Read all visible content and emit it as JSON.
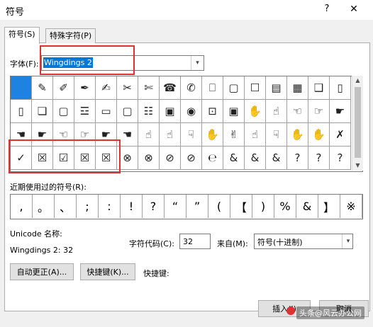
{
  "window": {
    "title": "符号",
    "help_glyph": "?",
    "close_glyph": "✕"
  },
  "tabs": [
    {
      "label": "符号(S)"
    },
    {
      "label": "特殊字符(P)"
    }
  ],
  "font": {
    "label": "字体(F):",
    "value": "Wingdings 2",
    "arrow": "▾"
  },
  "symbol_grid": {
    "selected_index": 0,
    "rows": [
      [
        "",
        "✎",
        "✐",
        "✒",
        "✍",
        "✂",
        "✄",
        "☎",
        "✆",
        "⎕",
        "▢",
        "☐",
        "▤",
        "▦",
        "❑",
        "▯"
      ],
      [
        "▯",
        "❏",
        "▢",
        "☲",
        "▭",
        "▢",
        "☷",
        "▣",
        "◉",
        "⊡",
        "▣",
        "✋",
        "☝",
        "☜",
        "☞",
        "☛"
      ],
      [
        "☚",
        "☛",
        "☜",
        "☞",
        "☛",
        "☚",
        "☝",
        "☝",
        "☟",
        "✋",
        "✌",
        "☝",
        "☟",
        "✋",
        "✋",
        "✗"
      ],
      [
        "✓",
        "☒",
        "☑",
        "☒",
        "☒",
        "⊗",
        "⊗",
        "⊘",
        "⊘",
        "℮",
        "&",
        "&",
        "&",
        "?",
        "?",
        "?"
      ]
    ]
  },
  "recent": {
    "label": "近期使用过的符号(R):",
    "items": [
      ",",
      "。",
      "、",
      ";",
      ":",
      "!",
      "?",
      "“",
      "”",
      "(",
      "【",
      ")",
      "%",
      "&",
      "】",
      "※"
    ]
  },
  "unicode_name": {
    "label": "Unicode 名称:",
    "value": "Wingdings 2: 32"
  },
  "char_code": {
    "label": "字符代码(C):",
    "value": "32"
  },
  "from": {
    "label": "来自(M):",
    "value": "符号(十进制)",
    "arrow": "▾"
  },
  "buttons": {
    "autocorrect": "自动更正(A)...",
    "shortcut_key": "快捷键(K)...",
    "shortcut_label": "快捷键:",
    "insert": "插入(I)",
    "cancel": "取消"
  },
  "watermark": "头条@风云办公网",
  "colors": {
    "selection": "#1e82e0",
    "highlight_box": "#e03030",
    "font_selection": "#0078d7"
  }
}
